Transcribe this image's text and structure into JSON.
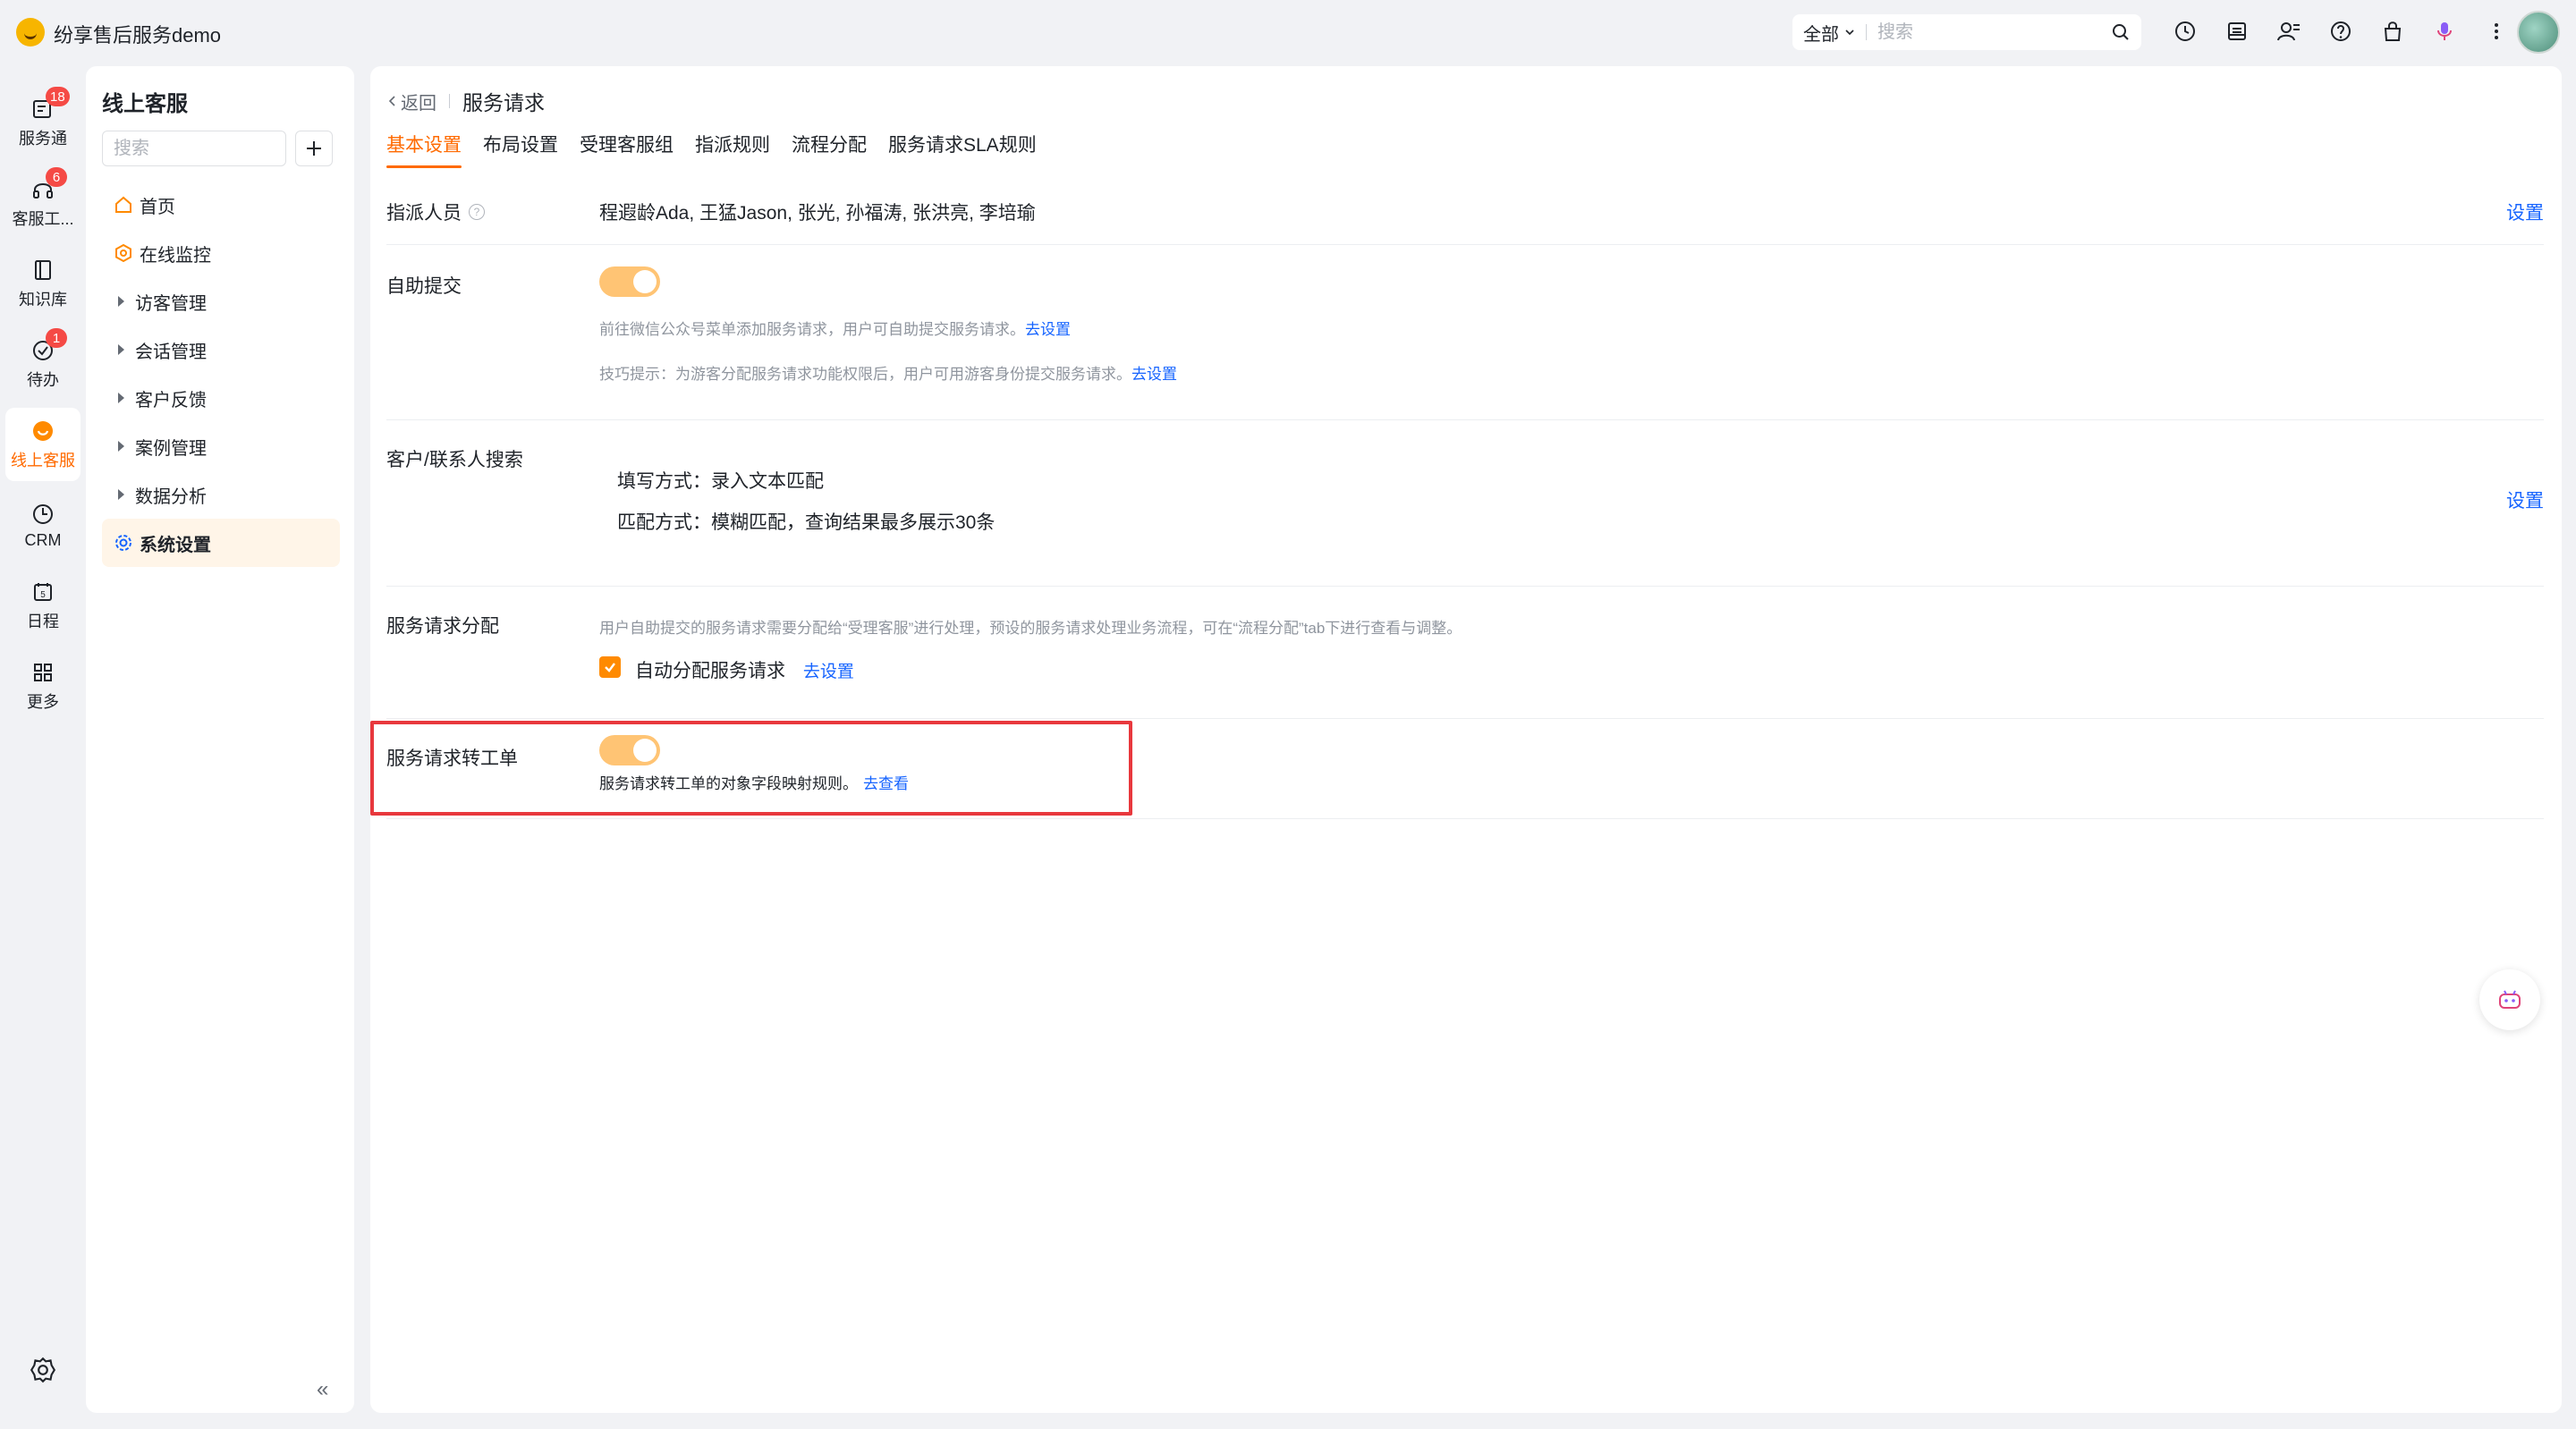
{
  "app": {
    "title": "纷享售后服务demo"
  },
  "topbar": {
    "scope": "全部",
    "search_placeholder": "搜索",
    "icons": [
      "clock-icon",
      "inbox-icon",
      "contacts-icon",
      "help-icon",
      "bag-icon",
      "microphone-icon",
      "more-icon"
    ]
  },
  "rail": {
    "items": [
      {
        "label": "服务通",
        "icon": "service-icon",
        "badge": "18"
      },
      {
        "label": "客服工...",
        "icon": "headset-icon",
        "badge": "6"
      },
      {
        "label": "知识库",
        "icon": "book-icon",
        "badge": ""
      },
      {
        "label": "待办",
        "icon": "check-icon",
        "badge": "1"
      },
      {
        "label": "线上客服",
        "icon": "online-service-icon",
        "badge": "",
        "active": true
      },
      {
        "label": "CRM",
        "icon": "crm-icon",
        "badge": ""
      },
      {
        "label": "日程",
        "icon": "calendar-icon",
        "badge": "",
        "day": "5"
      },
      {
        "label": "更多",
        "icon": "grid-icon",
        "badge": ""
      }
    ]
  },
  "sidebar": {
    "title": "线上客服",
    "search_placeholder": "搜索",
    "items": [
      {
        "label": "首页",
        "type": "home"
      },
      {
        "label": "在线监控",
        "type": "monitor"
      },
      {
        "label": "访客管理",
        "type": "group"
      },
      {
        "label": "会话管理",
        "type": "group"
      },
      {
        "label": "客户反馈",
        "type": "group"
      },
      {
        "label": "案例管理",
        "type": "group"
      },
      {
        "label": "数据分析",
        "type": "group"
      },
      {
        "label": "系统设置",
        "type": "settings",
        "active": true
      }
    ]
  },
  "main": {
    "back_label": "返回",
    "page_title": "服务请求",
    "tabs": [
      "基本设置",
      "布局设置",
      "受理客服组",
      "指派规则",
      "流程分配",
      "服务请求SLA规则"
    ],
    "active_tab": 0,
    "assignees": {
      "label": "指派人员",
      "value": "程遐龄Ada, 王猛Jason, 张光, 孙福涛, 张洪亮, 李培瑜",
      "action": "设置"
    },
    "self_submit": {
      "label": "自助提交",
      "enabled": true,
      "hint1": "前往微信公众号菜单添加服务请求，用户可自助提交服务请求。",
      "hint1_link": "去设置",
      "hint2": "技巧提示：为游客分配服务请求功能权限后，用户可用游客身份提交服务请求。",
      "hint2_link": "去设置"
    },
    "contact_search": {
      "label": "客户/联系人搜索",
      "fill_mode": "填写方式：录入文本匹配",
      "match_mode": "匹配方式：模糊匹配，查询结果最多展示30条",
      "action": "设置"
    },
    "distribution": {
      "label": "服务请求分配",
      "hint": "用户自助提交的服务请求需要分配给“受理客服”进行处理，预设的服务请求处理业务流程，可在“流程分配”tab下进行查看与调整。",
      "checkbox_label": "自动分配服务请求",
      "checked": true,
      "link": "去设置"
    },
    "to_workorder": {
      "label": "服务请求转工单",
      "enabled": true,
      "hint": "服务请求转工单的对象字段映射规则。",
      "link": "去查看"
    }
  },
  "colors": {
    "accent": "#ff6a00",
    "link": "#1664ff",
    "toggle": "#ffc474",
    "highlight": "#e8383d"
  }
}
